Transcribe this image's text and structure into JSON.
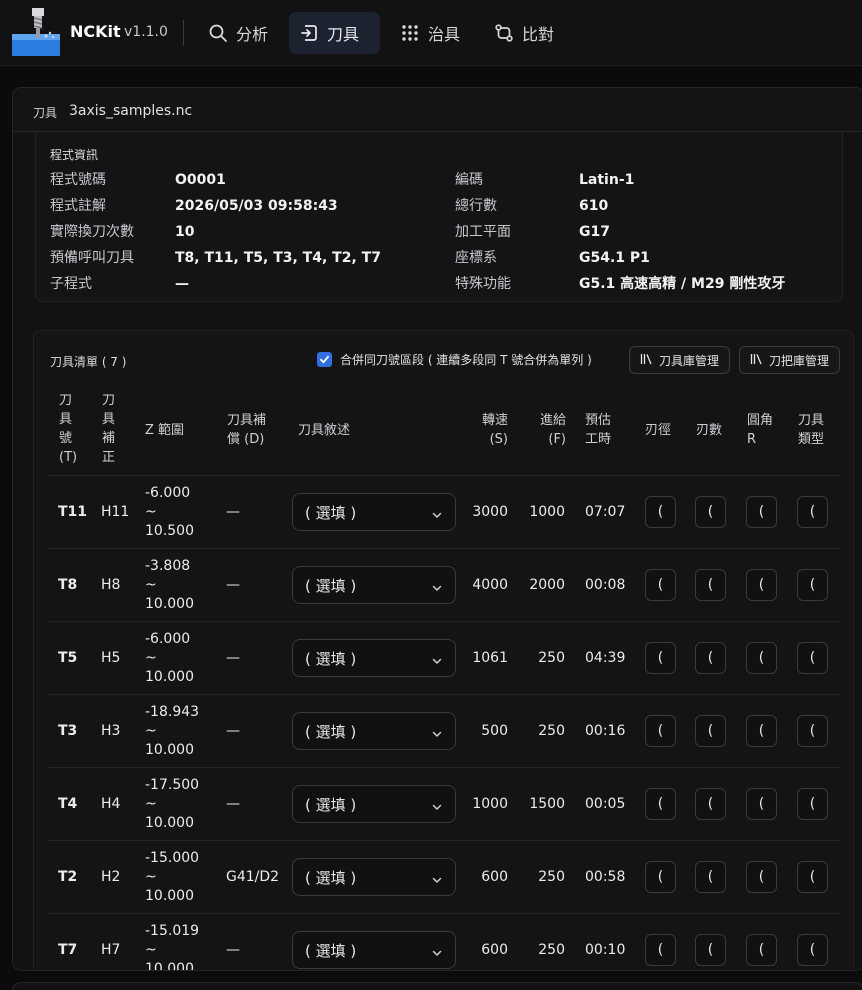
{
  "app": {
    "brand": "NCKit",
    "version": "v1.1.0"
  },
  "nav": [
    {
      "label": "分析",
      "icon": "search-icon"
    },
    {
      "label": "刀具",
      "icon": "tool-icon"
    },
    {
      "label": "治具",
      "icon": "grid-dots-icon"
    },
    {
      "label": "比對",
      "icon": "compare-icon"
    }
  ],
  "panel": {
    "label": "刀具",
    "file": "3axis_samples.nc"
  },
  "info": {
    "title": "程式資訊",
    "left": [
      {
        "label": "程式號碼",
        "value": "O0001"
      },
      {
        "label": "程式註解",
        "value": "2026/05/03 09:58:43"
      },
      {
        "label": "實際換刀次數",
        "value": "10"
      },
      {
        "label": "預備呼叫刀具",
        "value": "T8, T11, T5, T3, T4, T2, T7"
      },
      {
        "label": "子程式",
        "value": "—"
      }
    ],
    "right": [
      {
        "label": "編碼",
        "value": "Latin-1"
      },
      {
        "label": "總行數",
        "value": "610"
      },
      {
        "label": "加工平面",
        "value": "G17"
      },
      {
        "label": "座標系",
        "value": "G54.1 P1"
      },
      {
        "label": "特殊功能",
        "value": "G5.1 高速高精 / M29 剛性攻牙"
      }
    ]
  },
  "tools": {
    "title": "刀具清單 ( 7 )",
    "merge_label": "合併同刀號區段 ( 連續多段同 T 號合併為單列 )",
    "merge_checked": true,
    "btn_magazine": "刀具庫管理",
    "btn_holder": "刀把庫管理",
    "headers": {
      "t": [
        "刀",
        "具",
        "號",
        "(T)"
      ],
      "h": [
        "刀",
        "具",
        "補",
        "正"
      ],
      "z": [
        "Z 範圍"
      ],
      "d": [
        "刀具補",
        "償 (D)"
      ],
      "desc": [
        "刀具敘述"
      ],
      "s": [
        "轉速",
        "(S)"
      ],
      "f": [
        "進給",
        "(F)"
      ],
      "time": [
        "預估",
        "工時"
      ],
      "dia": [
        "刃徑"
      ],
      "flutes": [
        "刃數"
      ],
      "r": [
        "圓角",
        "R"
      ],
      "type": [
        "刀具",
        "類型"
      ]
    },
    "select_placeholder": "( 選填 )",
    "mini_placeholder": "(",
    "rows": [
      {
        "t": "T11",
        "h": "H11",
        "z_min": "-6.000",
        "z_sep": "~",
        "z_max": "10.500",
        "d": "—",
        "s": "3000",
        "f": "1000",
        "time": "07:07"
      },
      {
        "t": "T8",
        "h": "H8",
        "z_min": "-3.808",
        "z_sep": "~",
        "z_max": "10.000",
        "d": "—",
        "s": "4000",
        "f": "2000",
        "time": "00:08"
      },
      {
        "t": "T5",
        "h": "H5",
        "z_min": "-6.000",
        "z_sep": "~",
        "z_max": "10.000",
        "d": "—",
        "s": "1061",
        "f": "250",
        "time": "04:39"
      },
      {
        "t": "T3",
        "h": "H3",
        "z_min": "-18.943",
        "z_sep": "~",
        "z_max": "10.000",
        "d": "—",
        "s": "500",
        "f": "250",
        "time": "00:16"
      },
      {
        "t": "T4",
        "h": "H4",
        "z_min": "-17.500",
        "z_sep": "~",
        "z_max": "10.000",
        "d": "—",
        "s": "1000",
        "f": "1500",
        "time": "00:05"
      },
      {
        "t": "T2",
        "h": "H2",
        "z_min": "-15.000",
        "z_sep": "~",
        "z_max": "10.000",
        "d": "G41/D2",
        "s": "600",
        "f": "250",
        "time": "00:58"
      },
      {
        "t": "T7",
        "h": "H7",
        "z_min": "-15.019",
        "z_sep": "~",
        "z_max": "10.000",
        "d": "—",
        "s": "600",
        "f": "250",
        "time": "00:10"
      }
    ]
  },
  "colors": {
    "accent": "#2f6fe0",
    "active_nav_bg": "#1c2230",
    "bg": "#0b0b0c",
    "panel": "#121214"
  }
}
